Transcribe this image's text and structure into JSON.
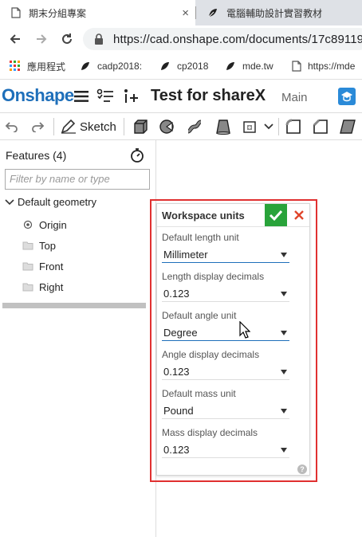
{
  "browser": {
    "tabs": [
      {
        "title": "期末分組專案",
        "close": "×"
      },
      {
        "title": "電腦輔助設計實習教材"
      }
    ],
    "url": "https://cad.onshape.com/documents/17c89119",
    "bookmarks": [
      {
        "label": "應用程式",
        "icon": "apps-grid-icon"
      },
      {
        "label": "cadp2018:",
        "icon": "leaf-bookmark-icon"
      },
      {
        "label": "cp2018",
        "icon": "leaf-bookmark-icon"
      },
      {
        "label": "mde.tw",
        "icon": "leaf-bookmark-icon"
      },
      {
        "label": "https://mde",
        "icon": "page-icon"
      }
    ]
  },
  "app": {
    "logo": "Onshape",
    "document_title": "Test for shareX",
    "branch": "Main",
    "accent_color": "#1e6fba"
  },
  "toolbar": {
    "sketch_label": "Sketch"
  },
  "features": {
    "title": "Features (4)",
    "filter_placeholder": "Filter by name or type",
    "group_label": "Default geometry",
    "items": [
      {
        "label": "Origin",
        "icon": "origin-icon"
      },
      {
        "label": "Top",
        "icon": "plane-icon"
      },
      {
        "label": "Front",
        "icon": "plane-icon"
      },
      {
        "label": "Right",
        "icon": "plane-icon"
      }
    ]
  },
  "dialog": {
    "title": "Workspace units",
    "ok_color": "#29a33a",
    "cancel_color": "#e0452b",
    "fields": [
      {
        "label": "Default length unit",
        "value": "Millimeter"
      },
      {
        "label": "Length display decimals",
        "value": "0.123"
      },
      {
        "label": "Default angle unit",
        "value": "Degree"
      },
      {
        "label": "Angle display decimals",
        "value": "0.123"
      },
      {
        "label": "Default mass unit",
        "value": "Pound"
      },
      {
        "label": "Mass display decimals",
        "value": "0.123"
      }
    ],
    "help": "?"
  }
}
